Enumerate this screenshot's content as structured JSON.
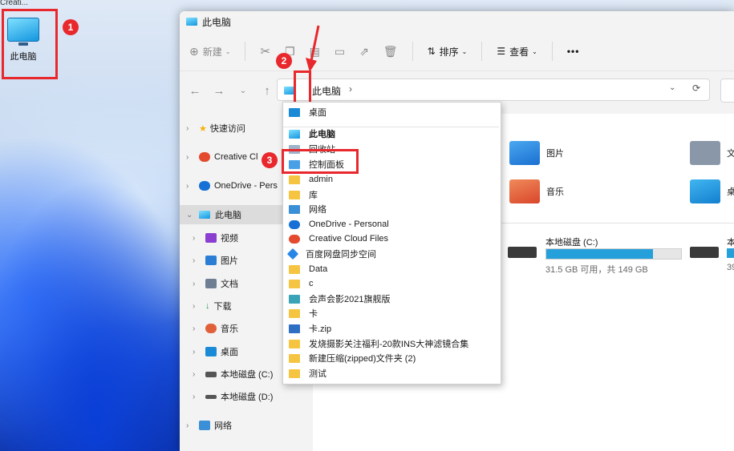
{
  "desktop": {
    "top_text": "Creati...",
    "icon_label": "此电脑"
  },
  "annotations": {
    "badge1": "1",
    "badge2": "2",
    "badge3": "3"
  },
  "colors": {
    "highlight": "#e8282c",
    "accent": "#26a0da"
  },
  "window": {
    "title": "此电脑"
  },
  "toolbar": {
    "new_label": "新建",
    "sort_label": "排序",
    "view_label": "查看",
    "more_label": "•••"
  },
  "address": {
    "crumb": "此电脑"
  },
  "sidebar": {
    "items": [
      {
        "label": "快速访问"
      },
      {
        "label": "Creative Cl"
      },
      {
        "label": "OneDrive - Pers"
      },
      {
        "label": "此电脑"
      },
      {
        "label": "视频"
      },
      {
        "label": "图片"
      },
      {
        "label": "文档"
      },
      {
        "label": "下载"
      },
      {
        "label": "音乐"
      },
      {
        "label": "桌面"
      },
      {
        "label": "本地磁盘 (C:)"
      },
      {
        "label": "本地磁盘 (D:)"
      },
      {
        "label": "网络"
      }
    ]
  },
  "content": {
    "folders": [
      {
        "label": "图片"
      },
      {
        "label": "文"
      },
      {
        "label": "音乐"
      },
      {
        "label": "桌"
      }
    ],
    "drives": [
      {
        "label": "本地磁盘 (C:)",
        "info": "31.5 GB 可用，共 149 GB",
        "used_fraction": 0.79
      },
      {
        "label": "本",
        "info": "39"
      }
    ]
  },
  "dropdown": {
    "items": [
      {
        "label": "桌面",
        "icon": "desktop-icon"
      },
      {
        "label": "此电脑",
        "icon": "pc-icon"
      },
      {
        "label": "回收站",
        "icon": "recycle-bin-icon"
      },
      {
        "label": "控制面板",
        "icon": "control-panel-icon"
      },
      {
        "label": "admin",
        "icon": "folder-icon"
      },
      {
        "label": "库",
        "icon": "folder-icon"
      },
      {
        "label": "网络",
        "icon": "network-icon"
      },
      {
        "label": "OneDrive - Personal",
        "icon": "cloud-icon"
      },
      {
        "label": "Creative Cloud Files",
        "icon": "creative-cloud-icon"
      },
      {
        "label": "百度网盘同步空间",
        "icon": "baidu-icon"
      },
      {
        "label": "Data",
        "icon": "folder-icon"
      },
      {
        "label": "c",
        "icon": "folder-icon"
      },
      {
        "label": "会声会影2021旗舰版",
        "icon": "app-icon"
      },
      {
        "label": "卡",
        "icon": "folder-icon"
      },
      {
        "label": "卡.zip",
        "icon": "zip-icon"
      },
      {
        "label": "发烧摄影关注福利-20款INS大神滤镜合集",
        "icon": "folder-icon"
      },
      {
        "label": "新建压缩(zipped)文件夹 (2)",
        "icon": "folder-icon"
      },
      {
        "label": "测试",
        "icon": "folder-icon"
      }
    ]
  }
}
